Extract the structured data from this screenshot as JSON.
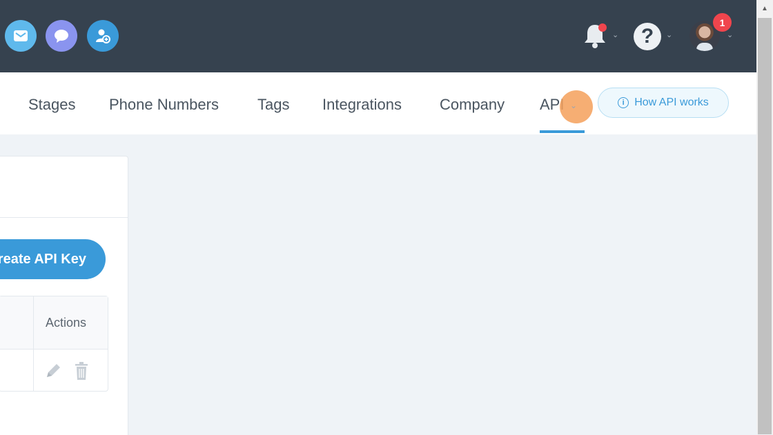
{
  "topbar": {
    "icons": [
      "mail-icon",
      "chat-icon",
      "user-add-icon",
      "bell-icon",
      "help-icon",
      "avatar"
    ],
    "help_label": "?",
    "notification_count": "1",
    "caret": "⌄"
  },
  "nav": {
    "tabs": [
      {
        "label": "Stages"
      },
      {
        "label": "Phone Numbers"
      },
      {
        "label": "Tags"
      },
      {
        "label": "Integrations"
      },
      {
        "label": "Company"
      },
      {
        "label": "API"
      }
    ],
    "active_tab": "API",
    "how_api_works": "How API works",
    "info_glyph": "i"
  },
  "card": {
    "create_button": "Create API Key",
    "table": {
      "columns": [
        "Actions"
      ]
    }
  },
  "colors": {
    "topbar": "#36424f",
    "accent": "#3a9ad9",
    "badge": "#f0454d"
  }
}
